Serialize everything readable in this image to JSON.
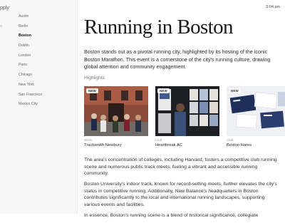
{
  "sidebar": {
    "brand": "pply",
    "items": [
      {
        "label": "Austin"
      },
      {
        "label": "Berlin"
      },
      {
        "label": "Boston"
      },
      {
        "label": "Dublin"
      },
      {
        "label": "London"
      },
      {
        "label": "Paris"
      },
      {
        "label": "Chicago"
      },
      {
        "label": "New York"
      },
      {
        "label": "San Francisco"
      },
      {
        "label": "Mexico City"
      }
    ],
    "active_item": "Boston"
  },
  "header": {
    "time": "5:04 pm"
  },
  "main": {
    "title": "Running in Boston",
    "intro": "Boston stands out as a pivotal running city, highlighted by its hosting of the iconic Boston Marathon. This event is a cornerstone of the city's running culture, drawing global attention and community engagement.",
    "highlights_label": "Highlights",
    "cards": [
      {
        "badge": "NEW",
        "category": "Store",
        "name": "Tracksmith Newbury"
      },
      {
        "badge": "NEW",
        "category": "Club",
        "name": "Heartbreak AC"
      },
      {
        "badge": "NEW",
        "category": "Club",
        "name": "Boston Hares"
      }
    ],
    "paragraphs": [
      "The area's concentration of colleges, including Harvard, fosters a competitive club running scene and numerous public track meets, fueling a vibrant and accessible running community.",
      "Boston University's indoor track, known for record-setting meets, further elevates the city's status in competitive running. Additionally, New Balance's headquarters in Boston contributes significantly to the local and international running landscapes, supporting various events and facilities.",
      "In essence, Boston's running scene is a blend of historical significance, collegiate"
    ]
  }
}
